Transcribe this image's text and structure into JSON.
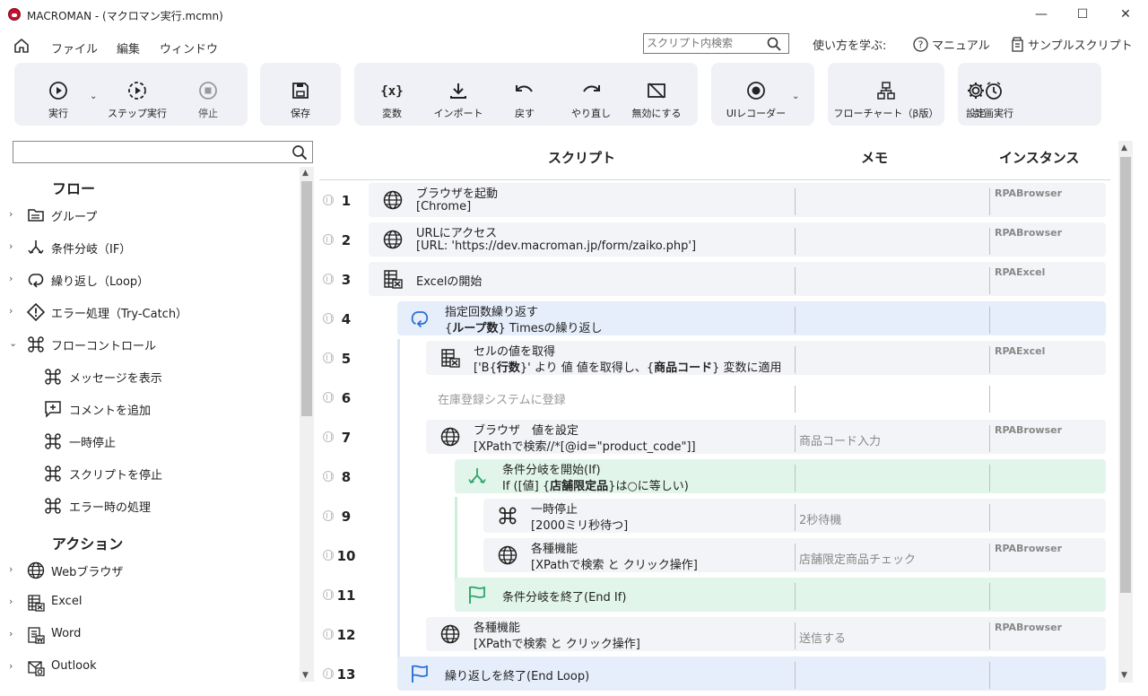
{
  "window": {
    "title": "MACROMAN - (マクロマン実行.mcmn)",
    "min": "—",
    "max": "☐",
    "close": "✕"
  },
  "menu": {
    "items": [
      "ファイル",
      "編集",
      "ウィンドウ"
    ],
    "search_placeholder": "スクリプト内検索",
    "learn_label": "使い方を学ぶ:",
    "manual_label": "マニュアル",
    "sample_label": "サンプルスクリプト"
  },
  "toolbar": {
    "run": "実行",
    "step": "ステップ実行",
    "stop": "停止",
    "save": "保存",
    "variable": "変数",
    "import": "インポート",
    "undo": "戻す",
    "redo": "やり直し",
    "disable": "無効にする",
    "ui_recorder": "UIレコーダー",
    "flowchart": "フローチャート（β版）",
    "schedule": "計画実行",
    "settings": "設定"
  },
  "left": {
    "search_value": "",
    "flow_heading": "フロー",
    "flow_items": [
      "グループ",
      "条件分岐（IF）",
      "繰り返し（Loop）",
      "エラー処理（Try-Catch）",
      "フローコントロール"
    ],
    "flow_control_children": [
      "メッセージを表示",
      "コメントを追加",
      "一時停止",
      "スクリプトを停止",
      "エラー時の処理"
    ],
    "action_heading": "アクション",
    "action_items": [
      "Webブラウザ",
      "Excel",
      "Word",
      "Outlook"
    ]
  },
  "columns": {
    "script": "スクリプト",
    "memo": "メモ",
    "instance": "インスタンス"
  },
  "rows": [
    {
      "num": "1",
      "title": "ブラウザを起動",
      "detail": "[Chrome]",
      "memo": "",
      "instance": "RPABrowser"
    },
    {
      "num": "2",
      "title": "URLにアクセス",
      "detail": "[URL: 'https://dev.macroman.jp/form/zaiko.php']",
      "memo": "",
      "instance": "RPABrowser"
    },
    {
      "num": "3",
      "title": "Excelの開始",
      "detail": "",
      "memo": "",
      "instance": "RPAExcel"
    },
    {
      "num": "4",
      "title": "指定回数繰り返す",
      "detail_pre": "{",
      "detail_bold": "ループ数",
      "detail_post": "} Timesの繰り返し",
      "memo": "",
      "instance": ""
    },
    {
      "num": "5",
      "title": "セルの値を取得",
      "detail_pre": "['B{",
      "detail_bold": "行数",
      "detail_mid": "}' より 値 値を取得し、{",
      "detail_bold2": "商品コード",
      "detail_post": "} 変数に適用",
      "memo": "",
      "instance": "RPAExcel"
    },
    {
      "num": "6",
      "title": "在庫登録システムに登録",
      "detail": "",
      "memo": "",
      "instance": ""
    },
    {
      "num": "7",
      "title": "ブラウザ　値を設定",
      "detail": "[XPathで検索//*[@id=\"product_code\"]]",
      "memo": "商品コード入力",
      "instance": "RPABrowser"
    },
    {
      "num": "8",
      "title": "条件分岐を開始(If)",
      "detail_pre": "If ([値] {",
      "detail_bold": "店舗限定品",
      "detail_post": "}は○に等しい)",
      "memo": "",
      "instance": ""
    },
    {
      "num": "9",
      "title": "一時停止",
      "detail": "[2000ミリ秒待つ]",
      "memo": "2秒待機",
      "instance": ""
    },
    {
      "num": "10",
      "title": "各種機能",
      "detail": "[XPathで検索 と クリック操作]",
      "memo": "店舗限定商品チェック",
      "instance": "RPABrowser"
    },
    {
      "num": "11",
      "title": "条件分岐を終了(End If)",
      "detail": "",
      "memo": "",
      "instance": ""
    },
    {
      "num": "12",
      "title": "各種機能",
      "detail": "[XPathで検索 と クリック操作]",
      "memo": "送信する",
      "instance": "RPABrowser"
    },
    {
      "num": "13",
      "title": "繰り返しを終了(End Loop)",
      "detail": "",
      "memo": "",
      "instance": ""
    }
  ],
  "colors": {
    "card": "#f3f4f7",
    "loop": "#e6eefb",
    "cond": "#e2f5ea",
    "toolbar_group": "#eff1f6",
    "accent_blue": "#2b6fd6",
    "accent_green": "#2ea66b"
  }
}
